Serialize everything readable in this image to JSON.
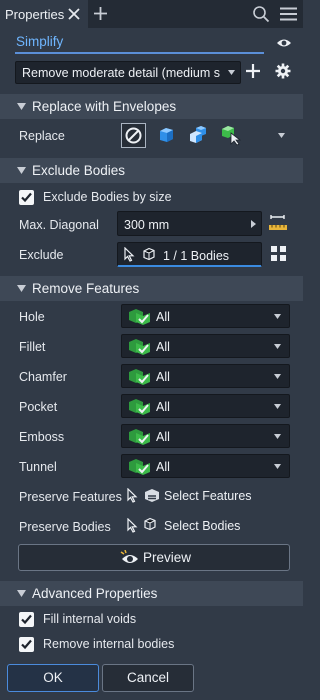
{
  "tab": {
    "title": "Properties"
  },
  "simplify_label": "Simplify",
  "detail_dropdown": {
    "value": "Remove moderate detail (medium si"
  },
  "sections": {
    "replace": "Replace with Envelopes",
    "exclude": "Exclude Bodies",
    "remove": "Remove Features",
    "advanced": "Advanced Properties"
  },
  "replace_label": "Replace",
  "exclude_by_size": {
    "label": "Exclude Bodies by size",
    "checked": true
  },
  "max_diagonal": {
    "label": "Max. Diagonal",
    "value": "300 mm"
  },
  "exclude": {
    "label": "Exclude",
    "value": "1 / 1 Bodies"
  },
  "features": [
    {
      "label": "Hole",
      "value": "All"
    },
    {
      "label": "Fillet",
      "value": "All"
    },
    {
      "label": "Chamfer",
      "value": "All"
    },
    {
      "label": "Pocket",
      "value": "All"
    },
    {
      "label": "Emboss",
      "value": "All"
    },
    {
      "label": "Tunnel",
      "value": "All"
    }
  ],
  "preserve_features": {
    "label": "Preserve Features",
    "value": "Select Features"
  },
  "preserve_bodies": {
    "label": "Preserve Bodies",
    "value": "Select Bodies"
  },
  "preview_label": "Preview",
  "fill_voids": {
    "label": "Fill internal voids",
    "checked": true
  },
  "remove_bodies": {
    "label": "Remove internal bodies",
    "checked": true
  },
  "ok_label": "OK",
  "cancel_label": "Cancel",
  "colors": {
    "accent": "#4b8bdc",
    "link": "#6fb6ff",
    "check_green": "#3dbb4a",
    "envelope_blue": "#2f8fe8"
  }
}
